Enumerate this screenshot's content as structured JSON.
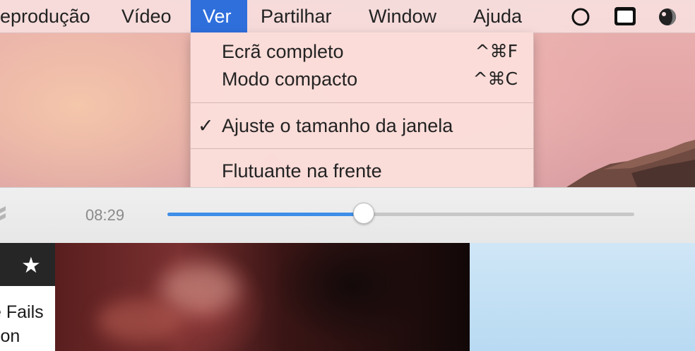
{
  "menubar": {
    "items": [
      {
        "label": "eprodução",
        "active": false
      },
      {
        "label": "Vídeo",
        "active": false
      },
      {
        "label": "Ver",
        "active": true
      },
      {
        "label": "Partilhar",
        "active": false
      },
      {
        "label": "Window",
        "active": false
      },
      {
        "label": "Ajuda",
        "active": false
      }
    ],
    "status_icons": [
      "circle-outline-icon",
      "screen-icon",
      "half-moon-icon"
    ]
  },
  "view_menu": {
    "items": [
      {
        "label": "Ecrã completo",
        "shortcut": "^⌘F",
        "checked": false
      },
      {
        "label": "Modo compacto",
        "shortcut": "^⌘C",
        "checked": false
      },
      {
        "label": "Ajuste o tamanho da janela",
        "shortcut": "",
        "checked": true,
        "check_mark": "✓"
      },
      {
        "label": "Flutuante na frente",
        "shortcut": "",
        "checked": false
      }
    ]
  },
  "player": {
    "elapsed_time": "08:29",
    "progress_fraction": 0.42,
    "accent_color": "#3e8ee8"
  },
  "thumbnails": {
    "left": {
      "star": "★",
      "title_lines": [
        "e Fails",
        "tion"
      ]
    }
  },
  "colors": {
    "menu_highlight": "#2f6fdc",
    "menubar_bg": "#f6dede"
  }
}
